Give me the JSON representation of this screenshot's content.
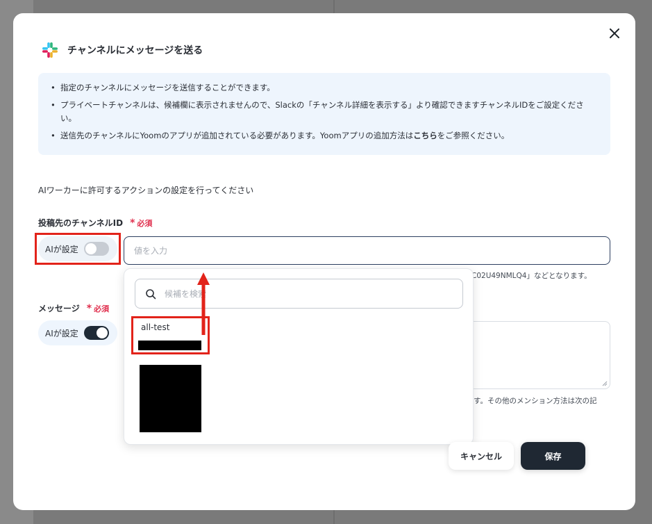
{
  "dialog": {
    "title": "チャンネルにメッセージを送る",
    "close_icon": "close-icon",
    "logo_icon": "slack-logo-icon"
  },
  "info": {
    "items": [
      "指定のチャンネルにメッセージを送信することができます。",
      "プライベートチャンネルは、候補欄に表示されませんので、Slackの「チャンネル詳細を表示する」より確認できますチャンネルIDをご設定ください。",
      "送信先のチャンネルにYoomのアプリが追加されている必要があります。Yoomアプリの追加方法は",
      "こちら",
      "をご参照ください。"
    ]
  },
  "form": {
    "section_description": "AIワーカーに許可するアクションの設定を行ってください",
    "channel_field": {
      "label": "投稿先のチャンネルID",
      "required_label": "必須",
      "ai_toggle_label": "AIが設定",
      "ai_toggle_on": false,
      "placeholder": "値を入力",
      "hint_fragment": "C02U49NMLQ4」などとなります。"
    },
    "message_field": {
      "label": "メッセージ",
      "required_label": "必須",
      "ai_toggle_label": "AIが設定",
      "ai_toggle_on": true,
      "hint_fragment": "きます。その他のメンション方法は次の記"
    }
  },
  "dropdown": {
    "search_placeholder": "候補を検索",
    "options": [
      "all-test"
    ]
  },
  "buttons": {
    "cancel": "キャンセル",
    "save": "保存"
  },
  "colors": {
    "highlight": "#e2231a",
    "primary_dark": "#1f2833",
    "required": "#e0304e",
    "info_bg": "#eef5fd"
  }
}
